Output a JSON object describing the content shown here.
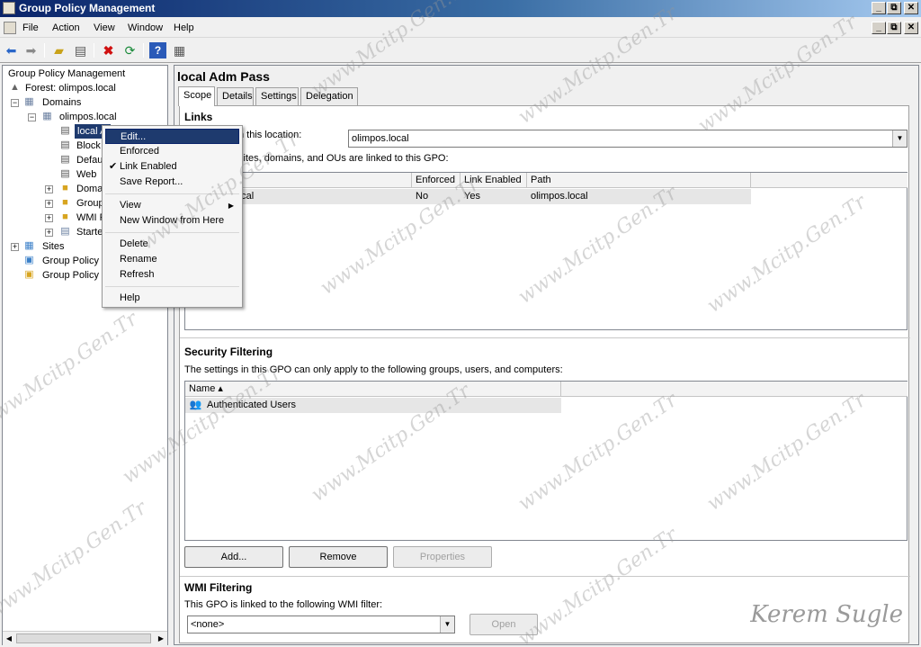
{
  "window": {
    "title": "Group Policy Management",
    "caption_buttons": [
      "_",
      "⧉",
      "✕"
    ]
  },
  "menubar": {
    "items": [
      "File",
      "Action",
      "View",
      "Window",
      "Help"
    ],
    "child_caption_buttons": [
      "_",
      "⧉",
      "✕"
    ]
  },
  "toolbar": {
    "icons": [
      "back-arrow-icon",
      "forward-arrow-icon",
      "up-folder-icon",
      "show-hide-tree-icon",
      "delete-icon",
      "refresh-icon",
      "help-icon",
      "properties-icon"
    ]
  },
  "tree": {
    "root": "Group Policy Management",
    "forest": "Forest: olimpos.local",
    "domains": "Domains",
    "domain": "olimpos.local",
    "children": [
      "local A",
      "Block",
      "Defau",
      "Web",
      "Doma",
      "Group",
      "WMI F",
      "Starte"
    ],
    "sites": "Sites",
    "gpm": "Group Policy M",
    "gpr": "Group Policy R"
  },
  "context_menu": {
    "items": [
      "Edit...",
      "Enforced",
      "Link Enabled",
      "Save Report...",
      "View",
      "New Window from Here",
      "Delete",
      "Rename",
      "Refresh",
      "Help"
    ],
    "checked_item": "Link Enabled"
  },
  "details": {
    "gpo_title": "local Adm Pass",
    "tabs": [
      "Scope",
      "Details",
      "Settings",
      "Delegation"
    ],
    "active_tab": "Scope",
    "links": {
      "heading": "Links",
      "location_label": "n this location:",
      "location_value": "olimpos.local",
      "description": "sites, domains, and OUs are linked to this GPO:",
      "columns": [
        "",
        "Enforced",
        "Link Enabled",
        "Path"
      ],
      "rows": [
        {
          "location": "ocal",
          "enforced": "No",
          "link_enabled": "Yes",
          "path": "olimpos.local"
        }
      ]
    },
    "security": {
      "heading": "Security Filtering",
      "description": "The settings in this GPO can only apply to the following groups, users, and computers:",
      "columns": [
        "Name ▴"
      ],
      "rows": [
        "Authenticated Users"
      ],
      "buttons": {
        "add": "Add...",
        "remove": "Remove",
        "properties": "Properties"
      }
    },
    "wmi": {
      "heading": "WMI Filtering",
      "description": "This GPO is linked to the following WMI filter:",
      "value": "<none>",
      "open_button": "Open"
    }
  },
  "watermark": {
    "text": "www.Mcitp.Gen.Tr",
    "signature": "Kerem Sugle"
  }
}
